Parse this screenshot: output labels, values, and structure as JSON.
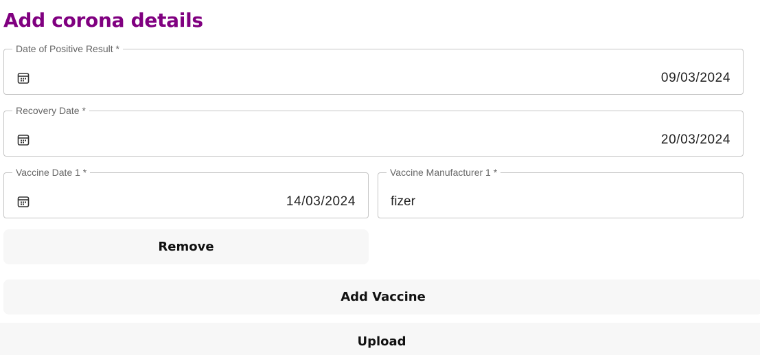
{
  "colors": {
    "title": "#800080",
    "border": "#c4c4c4",
    "button_bg": "#f7f7f7"
  },
  "form": {
    "title": "Add corona details",
    "positive_date": {
      "label": "Date of Positive Result *",
      "value": "09/03/2024",
      "icon": "calendar-icon"
    },
    "recovery_date": {
      "label": "Recovery Date *",
      "value": "20/03/2024",
      "icon": "calendar-icon"
    },
    "vaccines": [
      {
        "date_label": "Vaccine Date 1 *",
        "date_value": "14/03/2024",
        "manufacturer_label": "Vaccine Manufacturer 1 *",
        "manufacturer_value": "fizer",
        "remove_label": "Remove"
      }
    ],
    "add_vaccine_label": "Add Vaccine",
    "upload_label": "Upload"
  }
}
